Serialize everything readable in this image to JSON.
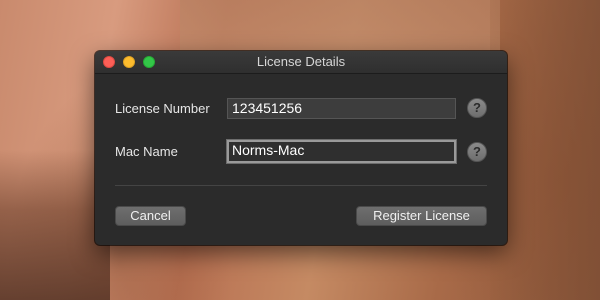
{
  "window": {
    "title": "License Details"
  },
  "form": {
    "license_number": {
      "label": "License Number",
      "value": "123451256",
      "help_icon": "question-icon",
      "help_glyph": "?"
    },
    "mac_name": {
      "label": "Mac Name",
      "value": "Norms-Mac",
      "help_icon": "question-icon",
      "help_glyph": "?"
    }
  },
  "buttons": {
    "cancel_label": "Cancel",
    "register_label": "Register License"
  },
  "colors": {
    "window_bg": "#2b2b2b",
    "close": "#fc5f57",
    "minimize": "#fdbc2e",
    "maximize": "#33c748"
  }
}
